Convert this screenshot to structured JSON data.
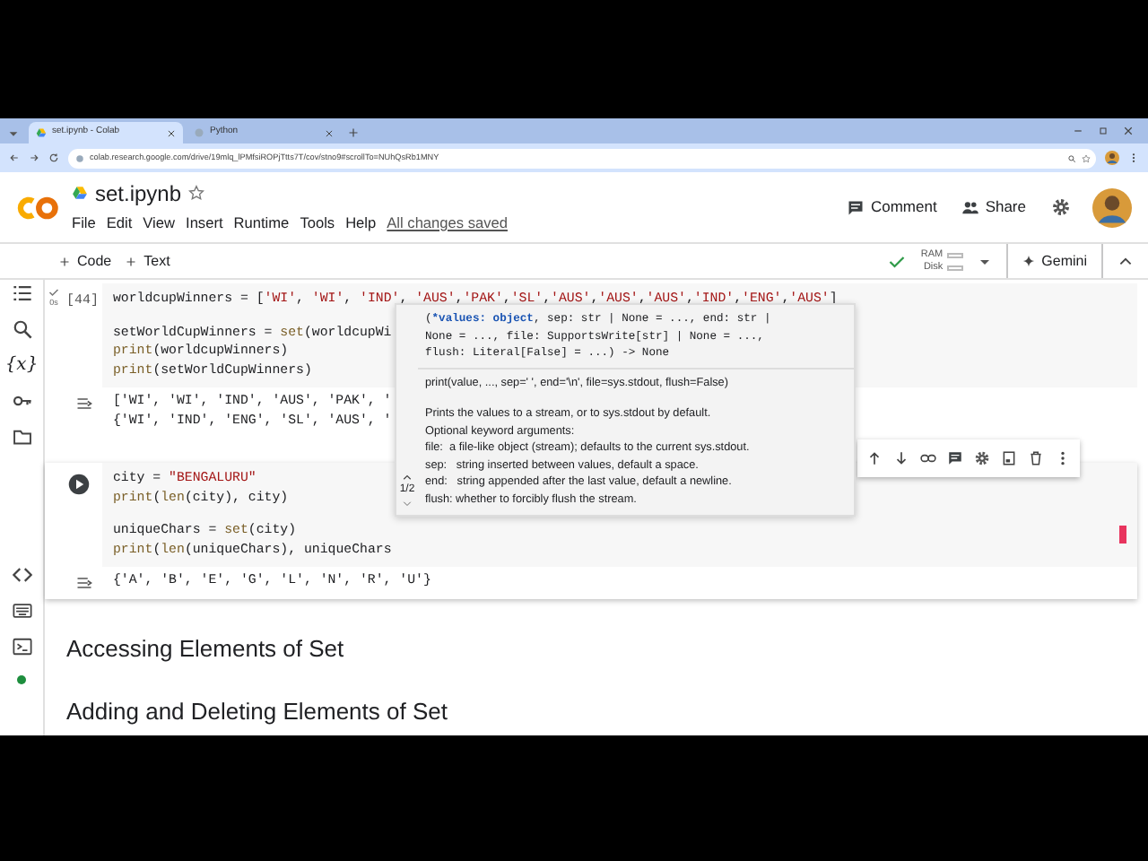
{
  "browser": {
    "tabs": [
      {
        "title": "set.ipynb - Colab",
        "selected": true
      },
      {
        "title": "Python",
        "selected": false
      }
    ],
    "address": "colab.research.google.com/drive/19mlq_lPMfsiROPjTtts7T/cov/stno9#scrollTo=NUhQsRb1MNY"
  },
  "header": {
    "title": "set.ipynb",
    "starred": false,
    "menu": [
      "File",
      "Edit",
      "View",
      "Insert",
      "Runtime",
      "Tools",
      "Help"
    ],
    "save_status": "All changes saved",
    "actions": [
      {
        "kind": "comment",
        "label": "Comment"
      },
      {
        "kind": "share",
        "label": "Share"
      }
    ]
  },
  "toolbar": {
    "add_buttons": [
      "Code",
      "Text"
    ],
    "connected": true,
    "ram_label": "RAM",
    "disk_label": "Disk",
    "gemini": "Gemini"
  },
  "sidebar": [
    {
      "kind": "toc"
    },
    {
      "kind": "search"
    },
    {
      "kind": "variables",
      "symbol": "{x}"
    },
    {
      "kind": "key"
    },
    {
      "kind": "folder"
    },
    {
      "kind": "gap"
    },
    {
      "kind": "code"
    },
    {
      "kind": "keyboard"
    },
    {
      "kind": "terminal"
    },
    {
      "kind": "status"
    }
  ],
  "cells": [
    {
      "kind": "code",
      "exec_count": "[44]",
      "duration": "0s",
      "focused": false,
      "blocks": [
        [
          [
            {
              "kind": "plain",
              "text": "worldcupWinners = ["
            },
            {
              "kind": "string",
              "text": "'WI'"
            },
            {
              "kind": "plain",
              "text": ", "
            },
            {
              "kind": "string",
              "text": "'WI'"
            },
            {
              "kind": "plain",
              "text": ", "
            },
            {
              "kind": "string",
              "text": "'IND'"
            },
            {
              "kind": "plain",
              "text": ", "
            },
            {
              "kind": "string",
              "text": "'AUS'"
            },
            {
              "kind": "plain",
              "text": ","
            },
            {
              "kind": "string",
              "text": "'PAK'"
            },
            {
              "kind": "plain",
              "text": ","
            },
            {
              "kind": "string",
              "text": "'SL'"
            },
            {
              "kind": "plain",
              "text": ","
            },
            {
              "kind": "string",
              "text": "'AUS'"
            },
            {
              "kind": "plain",
              "text": ","
            },
            {
              "kind": "string",
              "text": "'AUS'"
            },
            {
              "kind": "plain",
              "text": ","
            },
            {
              "kind": "string",
              "text": "'AUS'"
            },
            {
              "kind": "plain",
              "text": ","
            },
            {
              "kind": "string",
              "text": "'IND'"
            },
            {
              "kind": "plain",
              "text": ","
            },
            {
              "kind": "string",
              "text": "'ENG'"
            },
            {
              "kind": "plain",
              "text": ","
            },
            {
              "kind": "string",
              "text": "'AUS'"
            },
            {
              "kind": "plain",
              "text": "]"
            }
          ]
        ],
        [
          [
            {
              "kind": "plain",
              "text": "setWorldCupWinners = "
            },
            {
              "kind": "func",
              "text": "set"
            },
            {
              "kind": "plain",
              "text": "(worldcupWi"
            }
          ],
          [
            {
              "kind": "func",
              "text": "print"
            },
            {
              "kind": "plain",
              "text": "(worldcupWinners)"
            }
          ],
          [
            {
              "kind": "func",
              "text": "print"
            },
            {
              "kind": "plain",
              "text": "(setWorldCupWinners)"
            }
          ]
        ]
      ],
      "output": [
        "['WI', 'WI', 'IND', 'AUS', 'PAK', '",
        "{'WI', 'IND', 'ENG', 'SL', 'AUS', '"
      ]
    },
    {
      "kind": "code",
      "focused": true,
      "blocks": [
        [
          [
            {
              "kind": "plain",
              "text": "city = "
            },
            {
              "kind": "string",
              "text": "\"BENGALURU\""
            }
          ],
          [
            {
              "kind": "func",
              "text": "print"
            },
            {
              "kind": "plain",
              "text": "("
            },
            {
              "kind": "func",
              "text": "len"
            },
            {
              "kind": "plain",
              "text": "(city), city)"
            }
          ]
        ],
        [
          [
            {
              "kind": "plain",
              "text": "uniqueChars = "
            },
            {
              "kind": "func",
              "text": "set"
            },
            {
              "kind": "plain",
              "text": "(city)"
            }
          ],
          [
            {
              "kind": "func",
              "text": "print"
            },
            {
              "kind": "plain",
              "text": "("
            },
            {
              "kind": "func",
              "text": "len"
            },
            {
              "kind": "plain",
              "text": "(uniqueChars), uniqueChars"
            }
          ]
        ]
      ],
      "output": [
        "{'A', 'B', 'E', 'G', 'L', 'N', 'R', 'U'}"
      ]
    },
    {
      "kind": "heading",
      "text": "Accessing Elements of Set"
    },
    {
      "kind": "heading",
      "text": "Adding and Deleting Elements of Set"
    }
  ],
  "cell_toolbar": [
    {
      "kind": "up"
    },
    {
      "kind": "down"
    },
    {
      "kind": "link"
    },
    {
      "kind": "comment"
    },
    {
      "kind": "gear"
    },
    {
      "kind": "mirror"
    },
    {
      "kind": "trash"
    },
    {
      "kind": "more"
    }
  ],
  "tooltip": {
    "signature": [
      [
        {
          "kind": "plain",
          "text": "("
        },
        {
          "kind": "param",
          "text": "*values: object"
        },
        {
          "kind": "plain",
          "text": ", sep: str | None = ..., end: str |"
        }
      ],
      [
        {
          "kind": "plain",
          "text": "None = ..., file: SupportsWrite[str] | None = ...,"
        }
      ],
      [
        {
          "kind": "plain",
          "text": "flush: Literal[False] = ...) -> None"
        }
      ]
    ],
    "doc": [
      [
        "print(value, ..., sep=' ', end='\\n', file=sys.stdout, flush=False)"
      ],
      [
        "Prints the values to a stream, or to sys.stdout by default.",
        "Optional keyword arguments:",
        "file:  a file-like object (stream); defaults to the current sys.stdout.",
        "sep:   string inserted between values, default a space.",
        "end:   string appended after the last value, default a newline.",
        "flush: whether to forcibly flush the stream."
      ]
    ],
    "page": "1/2"
  }
}
